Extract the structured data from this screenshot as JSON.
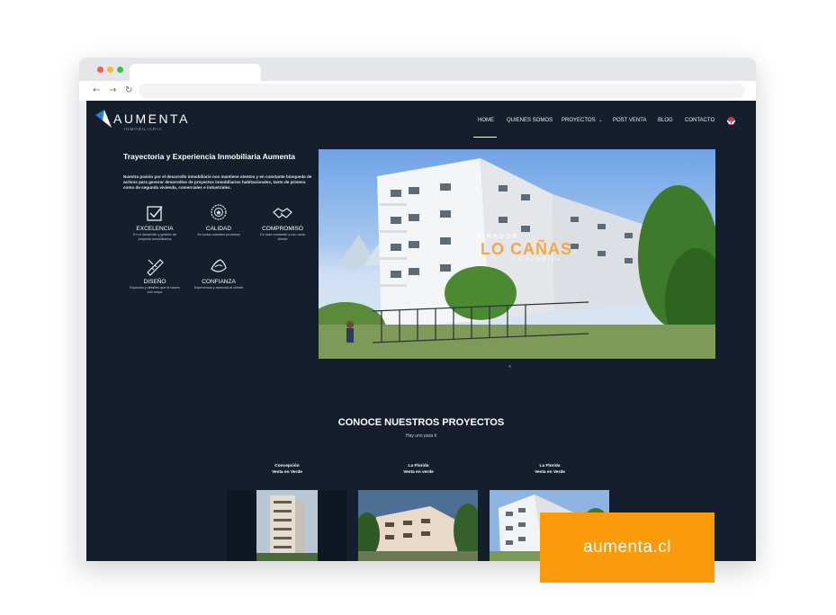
{
  "site": {
    "logo_text": "AUMENTA",
    "logo_subtext": "INMOBILIARIA",
    "nav": [
      "HOME",
      "QUIENES SOMOS",
      "PROYECTOS",
      "POST VENTA",
      "BLOG",
      "CONTACTO"
    ]
  },
  "intro": {
    "title": "Trayectoria y Experiencia Inmobiliaria Aumenta",
    "text": "Nuestra pasión por el desarrollo inmobiliario nos mantiene atentos y en constante búsqueda de activos para generar desarrollos de proyectos inmobiliarios habitacionales, tanto de primera como de segunda vivienda, comerciales e industriales.",
    "values": [
      {
        "title": "EXCELENCIA",
        "desc": "En el desarrollo y gestión de proyecto inmobiliarios",
        "icon": "check-square-icon"
      },
      {
        "title": "CALIDAD",
        "desc": "En todos nuestros procesos",
        "icon": "quality-seal-icon"
      },
      {
        "title": "COMPROMISO",
        "desc": "En todo momento y con cada cliente",
        "icon": "handshake-icon"
      },
      {
        "title": "DISEÑO",
        "desc": "Espacios y detalles que te hacen vivir mejor",
        "icon": "ruler-pencil-icon"
      },
      {
        "title": "CONFIANZA",
        "desc": "Experiencia y asesoría al cliente",
        "icon": "trust-hands-icon"
      }
    ]
  },
  "hero": {
    "line1": "MIRADOR",
    "line2": "LO CAÑAS",
    "line3": "LA FLORIDA"
  },
  "projects": {
    "title": "CONOCE NUESTROS PROYECTOS",
    "subtitle": "Hay uno para ti",
    "items": [
      {
        "commune": "Concepción",
        "name": "Vesta en Verde"
      },
      {
        "commune": "La Florida",
        "name": "Vesta en verde"
      },
      {
        "commune": "La Florida",
        "name": "Vesta en Verde"
      }
    ]
  },
  "badge": {
    "text": "aumenta.cl"
  },
  "colors": {
    "page_bg": "#151e2c",
    "accent": "#fb9a0a",
    "logo_blue": "#2a7fd4"
  }
}
